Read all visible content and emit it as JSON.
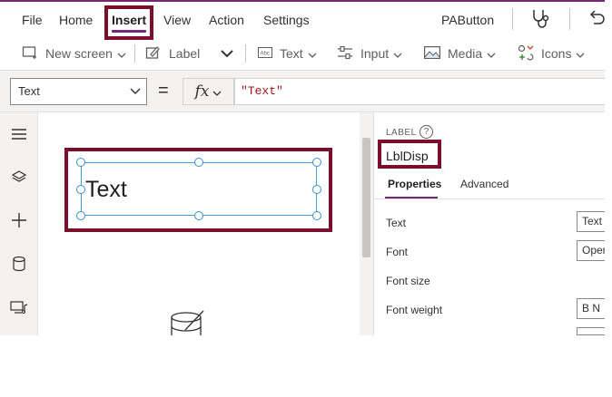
{
  "menu": {
    "file": "File",
    "home": "Home",
    "insert": "Insert",
    "view": "View",
    "action": "Action",
    "settings": "Settings",
    "app_name": "PAButton"
  },
  "toolbar": {
    "new_screen": "New screen",
    "label": "Label",
    "text": "Text",
    "input": "Input",
    "media": "Media",
    "icons": "Icons"
  },
  "formula": {
    "property": "Text",
    "equals": "=",
    "fx": "fx",
    "value": "\"Text\""
  },
  "canvas": {
    "label_text": "Text"
  },
  "panel": {
    "control_type": "LABEL",
    "help": "?",
    "control_name": "LblDisp",
    "tabs": [
      "Properties",
      "Advanced"
    ],
    "properties": [
      {
        "label": "Text",
        "value": "Text"
      },
      {
        "label": "Font",
        "value": "Open"
      },
      {
        "label": "Font size",
        "value": ""
      },
      {
        "label": "Font weight",
        "value": "B  N"
      }
    ]
  },
  "colors": {
    "accent": "#742774",
    "highlight_box": "#7a0f2c",
    "selection": "#4a9fd8"
  },
  "icons": [
    "new-screen-icon",
    "label-edit-icon",
    "text-input-icon",
    "input-sliders-icon",
    "media-image-icon",
    "icons-shapes-icon",
    "stethoscope-icon",
    "undo-icon",
    "hamburger-icon",
    "layers-icon",
    "plus-icon",
    "database-icon",
    "media-library-icon",
    "data-source-icon"
  ]
}
